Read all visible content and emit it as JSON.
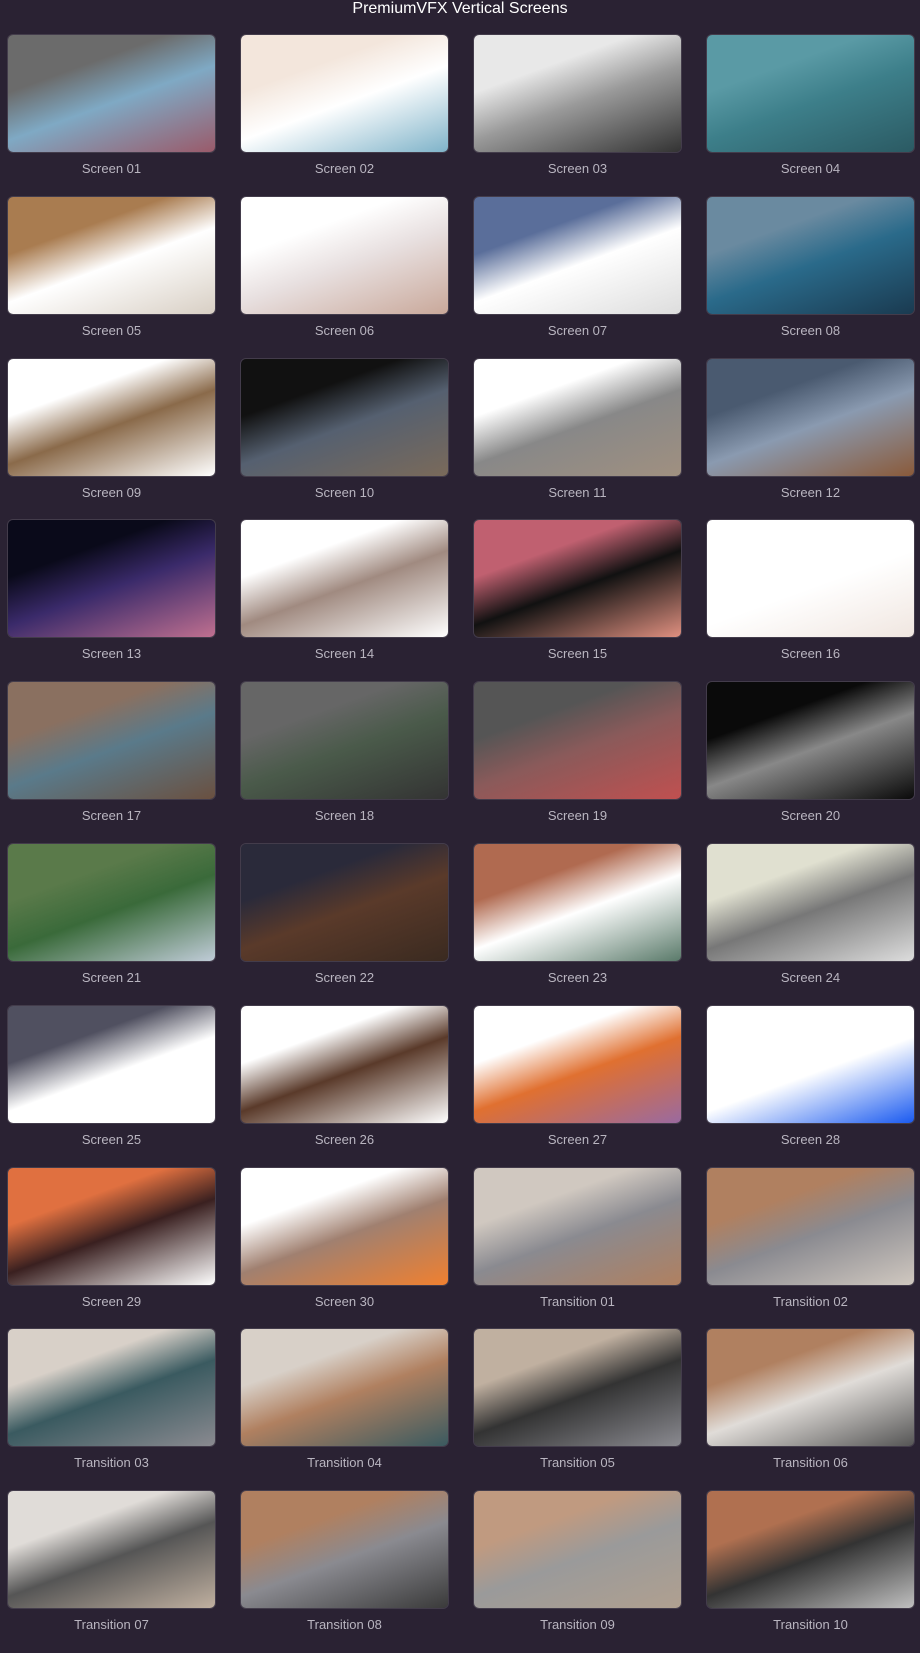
{
  "window": {
    "title": "PremiumVFX Vertical Screens"
  },
  "items": [
    {
      "label": "Screen 01",
      "colors": [
        "#6b6b6b",
        "#7fa9c4",
        "#9a5a6a"
      ]
    },
    {
      "label": "Screen 02",
      "colors": [
        "#f3e6dc",
        "#ffffff",
        "#7fb3c9"
      ]
    },
    {
      "label": "Screen 03",
      "colors": [
        "#e8e8e8",
        "#9a9a9a",
        "#333333"
      ]
    },
    {
      "label": "Screen 04",
      "colors": [
        "#5a9aa5",
        "#3d7f8a",
        "#2b5a63"
      ]
    },
    {
      "label": "Screen 05",
      "colors": [
        "#a97c50",
        "#ffffff",
        "#d8cfc4"
      ]
    },
    {
      "label": "Screen 06",
      "colors": [
        "#ffffff",
        "#e8e0e0",
        "#c9a89a"
      ]
    },
    {
      "label": "Screen 07",
      "colors": [
        "#5a6e9a",
        "#ffffff",
        "#dddddd"
      ]
    },
    {
      "label": "Screen 08",
      "colors": [
        "#6a8aa0",
        "#2a6a8a",
        "#1a3a50"
      ]
    },
    {
      "label": "Screen 09",
      "colors": [
        "#ffffff",
        "#8a6a4a",
        "#ffffff"
      ]
    },
    {
      "label": "Screen 10",
      "colors": [
        "#111111",
        "#556070",
        "#7a6a5a"
      ]
    },
    {
      "label": "Screen 11",
      "colors": [
        "#ffffff",
        "#888888",
        "#a09080"
      ]
    },
    {
      "label": "Screen 12",
      "colors": [
        "#4a5a70",
        "#8a9ab0",
        "#8a5a3a"
      ]
    },
    {
      "label": "Screen 13",
      "colors": [
        "#0a0a1a",
        "#3a2a6a",
        "#c07090"
      ]
    },
    {
      "label": "Screen 14",
      "colors": [
        "#ffffff",
        "#a08a80",
        "#ffffff"
      ]
    },
    {
      "label": "Screen 15",
      "colors": [
        "#c06070",
        "#111111",
        "#e09080"
      ]
    },
    {
      "label": "Screen 16",
      "colors": [
        "#ffffff",
        "#ffffff",
        "#f0e6e0"
      ]
    },
    {
      "label": "Screen 17",
      "colors": [
        "#8a7060",
        "#5a7a8a",
        "#6a5040"
      ]
    },
    {
      "label": "Screen 18",
      "colors": [
        "#666666",
        "#4a5a4a",
        "#333333"
      ]
    },
    {
      "label": "Screen 19",
      "colors": [
        "#555555",
        "#8a5a5a",
        "#c05050"
      ]
    },
    {
      "label": "Screen 20",
      "colors": [
        "#0a0a0a",
        "#888888",
        "#0a0a0a"
      ]
    },
    {
      "label": "Screen 21",
      "colors": [
        "#5a7a4a",
        "#3a6a3a",
        "#c0ccd8"
      ]
    },
    {
      "label": "Screen 22",
      "colors": [
        "#2a2a3a",
        "#5a3a2a",
        "#3a2a20"
      ]
    },
    {
      "label": "Screen 23",
      "colors": [
        "#b06a50",
        "#ffffff",
        "#5a7a6a"
      ]
    },
    {
      "label": "Screen 24",
      "colors": [
        "#e0e0d0",
        "#777777",
        "#dddddd"
      ]
    },
    {
      "label": "Screen 25",
      "colors": [
        "#505060",
        "#ffffff",
        "#ffffff"
      ]
    },
    {
      "label": "Screen 26",
      "colors": [
        "#ffffff",
        "#5a3a2a",
        "#ffffff"
      ]
    },
    {
      "label": "Screen 27",
      "colors": [
        "#ffffff",
        "#e07030",
        "#9a6aa0"
      ]
    },
    {
      "label": "Screen 28",
      "colors": [
        "#ffffff",
        "#ffffff",
        "#1a5af0"
      ]
    },
    {
      "label": "Screen 29",
      "colors": [
        "#e07040",
        "#3a2020",
        "#ffffff"
      ]
    },
    {
      "label": "Screen 30",
      "colors": [
        "#ffffff",
        "#a08070",
        "#f08030"
      ]
    },
    {
      "label": "Transition 01",
      "colors": [
        "#d0c8c0",
        "#8a8a90",
        "#b08060"
      ]
    },
    {
      "label": "Transition 02",
      "colors": [
        "#b08060",
        "#8a8a90",
        "#d0c8c0"
      ]
    },
    {
      "label": "Transition 03",
      "colors": [
        "#d8d0c8",
        "#3a5a60",
        "#8a8a90"
      ]
    },
    {
      "label": "Transition 04",
      "colors": [
        "#d8d0c8",
        "#b08060",
        "#3a5a60"
      ]
    },
    {
      "label": "Transition 05",
      "colors": [
        "#c0b0a0",
        "#333333",
        "#8a8a90"
      ]
    },
    {
      "label": "Transition 06",
      "colors": [
        "#b08060",
        "#e0dcd8",
        "#555555"
      ]
    },
    {
      "label": "Transition 07",
      "colors": [
        "#e0dcd8",
        "#555555",
        "#c0b0a0"
      ]
    },
    {
      "label": "Transition 08",
      "colors": [
        "#b08060",
        "#8a8a90",
        "#3a3a3a"
      ]
    },
    {
      "label": "Transition 09",
      "colors": [
        "#c09a80",
        "#9a9a9a",
        "#b0a090"
      ]
    },
    {
      "label": "Transition 10",
      "colors": [
        "#b07050",
        "#333333",
        "#c0c0c0"
      ]
    }
  ]
}
